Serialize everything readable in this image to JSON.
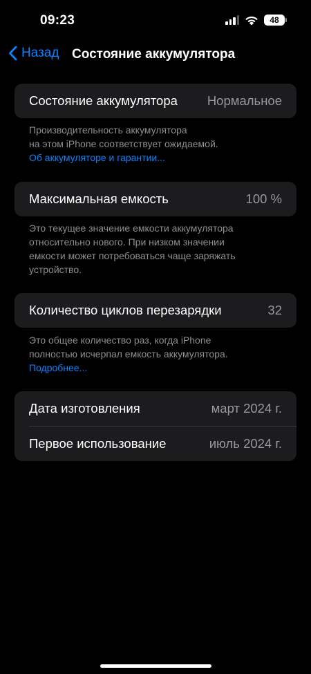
{
  "status_bar": {
    "time": "09:23",
    "battery_level": "48",
    "icons": [
      "signal-icon",
      "wifi-icon",
      "battery-icon"
    ]
  },
  "nav": {
    "back_label": "Назад",
    "title": "Состояние аккумулятора"
  },
  "sections": {
    "health": {
      "label": "Состояние аккумулятора",
      "value": "Нормальное",
      "footnote_line1": "Производительность аккумулятора",
      "footnote_line2": "на этом iPhone соответствует ожидаемой.",
      "link": "Об аккумуляторе и гарантии..."
    },
    "capacity": {
      "label": "Максимальная емкость",
      "value": "100 %",
      "footnote_line1": "Это текущее значение емкости аккумулятора",
      "footnote_line2": "относительно нового. При низком значении",
      "footnote_line3": "емкости может потребоваться чаще заряжать",
      "footnote_line4": "устройство."
    },
    "cycles": {
      "label": "Количество циклов перезарядки",
      "value": "32",
      "footnote_line1": "Это общее количество раз, когда iPhone",
      "footnote_line2": "полностью исчерпал емкость аккумулятора.",
      "link": "Подробнее..."
    },
    "dates": {
      "manufacture_label": "Дата изготовления",
      "manufacture_value": "март 2024 г.",
      "first_use_label": "Первое использование",
      "first_use_value": "июль 2024 г."
    }
  },
  "colors": {
    "accent": "#0a84ff",
    "background": "#000000",
    "card": "#1c1c1e",
    "secondary_text": "#8e8e93"
  }
}
